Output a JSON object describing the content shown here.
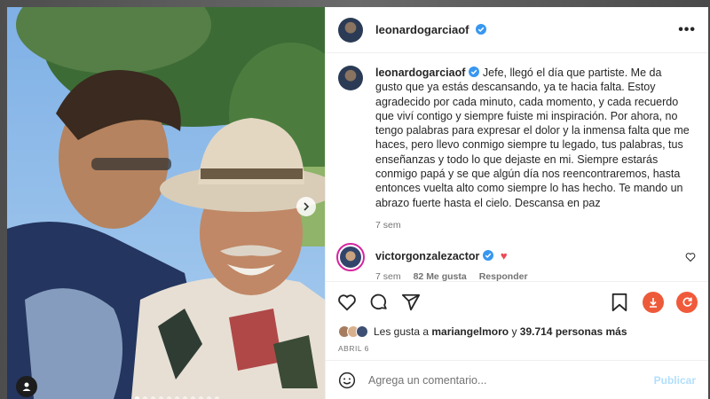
{
  "post": {
    "username": "leonardogarciaof",
    "more_label": "•••",
    "caption_text": "Jefe, llegó el día que partiste. Me da gusto que ya estás descansando, ya te hacia falta. Estoy agradecido por cada minuto, cada momento, y cada recuerdo que viví contigo y siempre fuiste mi inspiración. Por ahora, no tengo palabras para expresar el dolor y la inmensa falta que me haces, pero llevo conmigo siempre tu legado, tus palabras, tus enseñanzas y todo lo que dejaste en mi. Siempre estarás conmigo papá y se que algún día nos reencontraremos, hasta entonces vuelta alto como siempre lo has hecho. Te mando un abrazo fuerte hasta el cielo. Descansa en paz",
    "caption_time": "7 sem"
  },
  "reply": {
    "username": "victorgonzalezactor",
    "heart": "♥",
    "time": "7 sem",
    "likes": "82 Me gusta",
    "reply_label": "Responder"
  },
  "likes": {
    "prefix": "Les gusta a",
    "user": "mariangelmoro",
    "joiner": "y",
    "count": "39.714 personas más"
  },
  "date": "ABRIL 6",
  "composer": {
    "placeholder": "Agrega un comentario...",
    "post_label": "Publicar"
  },
  "carousel": {
    "total": 11,
    "active": 0
  },
  "colors": {
    "verified": "#3897f0",
    "heart": "#ed4956",
    "download": "#ed5a3a",
    "refresh": "#f05a3a",
    "post_button": "#b2dffc"
  },
  "icons": [
    "verified-icon",
    "more-icon",
    "like-icon",
    "comment-icon",
    "share-icon",
    "bookmark-icon",
    "download-icon",
    "refresh-icon",
    "emoji-icon",
    "next-arrow-icon",
    "user-tag-icon"
  ]
}
